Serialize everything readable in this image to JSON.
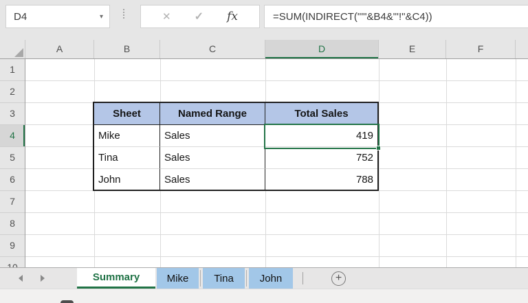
{
  "formula_bar": {
    "name_box_value": "D4",
    "formula": "=SUM(INDIRECT(\"'\"&B4&\"'!\"&C4))",
    "icons": {
      "name_box_caret": "▾",
      "cancel": "✕",
      "enter": "✓",
      "insert_function": "fx"
    }
  },
  "grid": {
    "column_headers": [
      "A",
      "B",
      "C",
      "D",
      "E",
      "F"
    ],
    "row_headers": [
      "1",
      "2",
      "3",
      "4",
      "5",
      "6",
      "7",
      "8",
      "9",
      "10"
    ],
    "selected_column": "D",
    "selected_row": "4",
    "active_cell": "D4"
  },
  "table": {
    "headers": [
      "Sheet",
      "Named Range",
      "Total Sales"
    ],
    "rows": [
      {
        "sheet": "Mike",
        "named_range": "Sales",
        "total_sales": "419"
      },
      {
        "sheet": "Tina",
        "named_range": "Sales",
        "total_sales": "752"
      },
      {
        "sheet": "John",
        "named_range": "Sales",
        "total_sales": "788"
      }
    ]
  },
  "sheet_tabs": {
    "active_tab": "Summary",
    "tabs": [
      {
        "label": "Summary"
      },
      {
        "label": "Mike"
      },
      {
        "label": "Tina"
      },
      {
        "label": "John"
      }
    ],
    "add_sheet_icon": "+"
  },
  "colors": {
    "selection_green": "#217346",
    "table_header_fill": "#B4C6E7",
    "inactive_tab_blue": "#A2C7E8",
    "active_tab_text": "#1F7245"
  }
}
